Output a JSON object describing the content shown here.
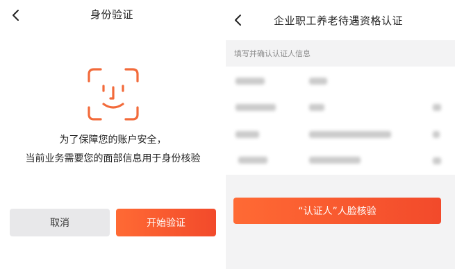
{
  "left": {
    "nav_title": "身份验证",
    "prompt_line1": "为了保障您的账户安全，",
    "prompt_line2": "当前业务需要您的面部信息用于身份核验",
    "cancel_label": "取消",
    "start_label": "开始验证"
  },
  "right": {
    "nav_title": "企业职工养老待遇资格认证",
    "section_label": "填写并确认认证人信息",
    "verify_label": "“认证人”人脸核验"
  },
  "icons": {
    "back": "chevron-left-icon",
    "face": "face-scan-icon"
  },
  "colors": {
    "accent": "#f4502d",
    "face_icon": "#f26a3a",
    "cancel_bg": "#e8e8ea"
  }
}
